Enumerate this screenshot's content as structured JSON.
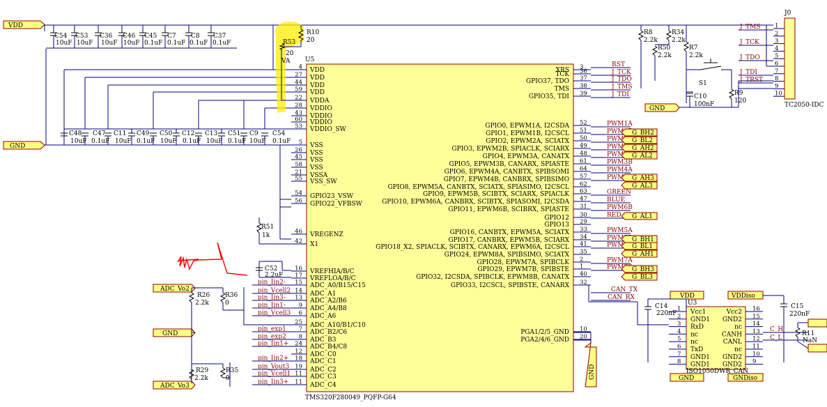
{
  "power_nets": {
    "vdd": "VDD",
    "gnd": "GND",
    "vddiso": "VDDiso",
    "gndiso": "GNDiso"
  },
  "top_caps": [
    {
      "ref": "C54",
      "val": "10uF"
    },
    {
      "ref": "C53",
      "val": "10uF"
    },
    {
      "ref": "C36",
      "val": "10uF"
    },
    {
      "ref": "C46",
      "val": "10uF"
    },
    {
      "ref": "C45",
      "val": "0.1uF"
    },
    {
      "ref": "C7",
      "val": "0.1uF"
    },
    {
      "ref": "C8",
      "val": "0.1uF"
    },
    {
      "ref": "C37",
      "val": "0.1uF"
    }
  ],
  "bottom_caps": [
    {
      "ref": "C48",
      "val": "10uF"
    },
    {
      "ref": "C47",
      "val": "0.1uF"
    },
    {
      "ref": "C11",
      "val": "10uF"
    },
    {
      "ref": "C49",
      "val": "0.1uF"
    },
    {
      "ref": "C50",
      "val": "10uF"
    },
    {
      "ref": "C12",
      "val": "0.1uF"
    },
    {
      "ref": "C13",
      "val": "10uF"
    },
    {
      "ref": "C51",
      "val": "0.1uF"
    },
    {
      "ref": "C9",
      "val": "10uF"
    },
    {
      "ref": "C54",
      "val": "0.1uF"
    }
  ],
  "r10": {
    "ref": "R10",
    "val": "20"
  },
  "r53": {
    "ref": "R53",
    "val": "20"
  },
  "va_label": "VA",
  "u5": {
    "ref": "U5",
    "part": "TMS320F280049_PQFP-G64",
    "left_pins": [
      {
        "num": "4",
        "name": "VDD"
      },
      {
        "num": "27",
        "name": "VDD"
      },
      {
        "num": "44",
        "name": "VDD"
      },
      {
        "num": "59",
        "name": "VDD"
      },
      {
        "num": "22",
        "name": "VDDA"
      },
      {
        "num": "28",
        "name": "VDDIO"
      },
      {
        "num": "43",
        "name": "VDDIO"
      },
      {
        "num": "60",
        "name": "VDDIO"
      },
      {
        "num": "53",
        "name": "VDDIO_SW"
      },
      {
        "num": "5",
        "name": "VSS"
      },
      {
        "num": "26",
        "name": "VSS"
      },
      {
        "num": "45",
        "name": "VSS"
      },
      {
        "num": "58",
        "name": "VSS"
      },
      {
        "num": "21",
        "name": "VSSA"
      },
      {
        "num": "55",
        "name": "VSS_SW"
      },
      {
        "num": "54",
        "name": "GPIO23_VSW"
      },
      {
        "num": "56",
        "name": "GPIO22_VFBSW"
      },
      {
        "num": "46",
        "name": "VREGENZ"
      },
      {
        "num": "42",
        "name": "X1"
      },
      {
        "num": "16",
        "name": "VREFHIA/B/C"
      },
      {
        "num": "17",
        "name": "VREFLOA/B/C"
      },
      {
        "num": "15",
        "name": "ADC_A0/B15/C15"
      },
      {
        "num": "14",
        "name": "ADC_A1"
      },
      {
        "num": "13",
        "name": "ADC_A2/B6"
      },
      {
        "num": "9",
        "name": "ADC_A4/B8"
      },
      {
        "num": "6",
        "name": "ADC_A6"
      },
      {
        "num": "25",
        "name": "ADC_A10/B1/C10"
      },
      {
        "num": "7",
        "name": "ADC_B2/C6"
      },
      {
        "num": "8",
        "name": "ADC_B3"
      },
      {
        "num": "24",
        "name": "ADC_B4/C8"
      },
      {
        "num": "12",
        "name": "ADC_C0"
      },
      {
        "num": "18",
        "name": "ADC_C1"
      },
      {
        "num": "19",
        "name": "ADC_C2"
      },
      {
        "num": "11",
        "name": "ADC_C3"
      },
      {
        "num": "11",
        "name": "ADC_C4"
      }
    ],
    "right_pins": [
      {
        "num": "3",
        "name": "XRS"
      },
      {
        "num": "36",
        "name": "TCK"
      },
      {
        "num": "37",
        "name": "GPIO37, TDO"
      },
      {
        "num": "38",
        "name": "TMS"
      },
      {
        "num": "39",
        "name": "GPIO35, TDI"
      },
      {
        "num": "52",
        "name": "GPIO0, EPWM1A, I2CSDA"
      },
      {
        "num": "51",
        "name": "GPIO1, EPWM1B, I2CSCL"
      },
      {
        "num": "50",
        "name": "GPIO2, EPWM2A, SCIATX"
      },
      {
        "num": "49",
        "name": "GPIO3, EPWM2B, SPIACLK, SCIARX"
      },
      {
        "num": "48",
        "name": "GPIO4, EPWM3A, CANATX"
      },
      {
        "num": "61",
        "name": "GPIO5, EPWM3B, CANARX, SPIASTE"
      },
      {
        "num": "64",
        "name": "GPIO6, EPWM4A, CANBTX, SPIBSOMI"
      },
      {
        "num": "57",
        "name": "GPIO7, EPWM4B, CANBRX, SPIBSIMO"
      },
      {
        "num": "62",
        "name": "GPIO8, EPWM5A, CANBTX, SCIATX, SPIASIMO, I2CSCL"
      },
      {
        "num": "63",
        "name": "GPIO9, EPWM5B, SCIBTX, SCIARX, SPIACLK"
      },
      {
        "num": "47",
        "name": "GPIO10, EPWM6A, CANBRX, SCIBTX, SPIASOMI, I2CSDA"
      },
      {
        "num": "31",
        "name": "GPIO11, EPWM6B, SCIBRX, SPIASTE"
      },
      {
        "num": "30",
        "name": "GPIO12"
      },
      {
        "num": "29",
        "name": "GPIO13"
      },
      {
        "num": "33",
        "name": "GPIO16, CANBTX, EPWM5A, SCIATX"
      },
      {
        "num": "34",
        "name": "GPIO17, CANBRX, EPWM5B, SCIARX"
      },
      {
        "num": "41",
        "name": "GPIO18_X2, SPIACLK, SCIBTX, CANARX, EPWM6A, I2CSCL"
      },
      {
        "num": "35",
        "name": "GPIO24, EPWM8A, SPIBSIMO, SCIATX"
      },
      {
        "num": "2",
        "name": "GPIO28, EPWM7A, SPIBCLK"
      },
      {
        "num": "1",
        "name": "GPIO29, EPWM7B, SPIBSTE"
      },
      {
        "num": "40",
        "name": "GPIO32, I2CSDA, SPIBCLK, EPWM8B, CANATX"
      },
      {
        "num": "32",
        "name": "GPIO33, I2CSCL, SPIBSTE, CANARX"
      },
      {
        "num": "10",
        "name": "PGA1/2/5_GND"
      },
      {
        "num": "20",
        "name": "PGA2/4/6_GND"
      }
    ]
  },
  "right_labels": [
    "RST",
    "J_TCK",
    "J_TDO",
    "J_TMS",
    "J_TDI",
    "PWM1A",
    "PWM1B",
    "PWM2A",
    "PWM2B",
    "PWM3A",
    "PWM3B",
    "PWM4A",
    "PWM4B",
    "GREEN",
    "BLUE",
    "PWM6B",
    "RED",
    "PWM5A",
    "PWM5B",
    "PWM6A",
    "PWM7A",
    "PWM7B",
    "CAN_TX",
    "CAN_RX"
  ],
  "gate_flags": [
    "G_BH2",
    "G_BL2",
    "G_AH2",
    "G_AL2",
    "G_AH3",
    "G_AL3",
    "G_AL1",
    "G_BH1",
    "G_BL1",
    "G_AH1",
    "G_BH3",
    "G_BL3"
  ],
  "left_labels": [
    "pin_Iin2-",
    "pin_Vcell2",
    "pin_Iin3-",
    "pin_Iin1-",
    "pin_Vcell3",
    "pin_exp1",
    "pin_exp2",
    "pin_Iin1+",
    "pin_Iin2+",
    "pin_Vout3",
    "pin_Vcell1",
    "pin_Iin3+"
  ],
  "adc_flags": {
    "vo2": "ADC_Vo2",
    "vo3": "ADC_Vo3"
  },
  "left_parts": {
    "r26": {
      "ref": "R26",
      "val": "2.2k"
    },
    "r36": {
      "ref": "R36",
      "val": "0"
    },
    "r29": {
      "ref": "R29",
      "val": "2.2k"
    },
    "r35": {
      "ref": "R35",
      "val": "0"
    },
    "r51": {
      "ref": "R51",
      "val": "1k"
    },
    "c52": {
      "ref": "C52",
      "val": "2.2uF"
    }
  },
  "jtag": {
    "r8": {
      "ref": "R8",
      "val": "2.2k"
    },
    "r34": {
      "ref": "R34",
      "val": "2.2k"
    },
    "r50": {
      "ref": "R50",
      "val": "2.2k"
    },
    "r7": {
      "ref": "R7",
      "val": "2.2k"
    },
    "s1": "S1",
    "c10": {
      "ref": "C10",
      "val": "100nF"
    },
    "r9": {
      "ref": "R9",
      "val": "120"
    },
    "j0": {
      "ref": "J0",
      "part": "TC2050-IDC"
    },
    "j0_nets": [
      "J_TMS",
      "J_TCK",
      "J_TDO",
      "J_TDI",
      "J_TRST"
    ]
  },
  "iso": {
    "ref": "U3",
    "part": "ISO1050DWR_CAN",
    "left_pins": [
      {
        "num": "1",
        "name": "Vcc1"
      },
      {
        "num": "2",
        "name": "GND1"
      },
      {
        "num": "3",
        "name": "RxD"
      },
      {
        "num": "4",
        "name": "nc"
      },
      {
        "num": "5",
        "name": "nc"
      },
      {
        "num": "6",
        "name": "TxD"
      },
      {
        "num": "7",
        "name": "GND1"
      },
      {
        "num": "8",
        "name": "GND1"
      }
    ],
    "right_pins": [
      {
        "num": "16",
        "name": "Vcc2"
      },
      {
        "num": "15",
        "name": "GND2"
      },
      {
        "num": "14",
        "name": "nc"
      },
      {
        "num": "13",
        "name": "CANH"
      },
      {
        "num": "12",
        "name": "CANL"
      },
      {
        "num": "11",
        "name": "nc"
      },
      {
        "num": "10",
        "name": "GND2"
      },
      {
        "num": "9",
        "name": "GND2"
      }
    ],
    "c14": {
      "ref": "C14",
      "val": "220nF"
    },
    "c15": {
      "ref": "C15",
      "val": "220nF"
    },
    "r11": {
      "ref": "R11",
      "val": "NaN"
    },
    "c_h": "C_H",
    "c_l": "C_L"
  },
  "colors": {
    "wire": "#00007e",
    "label": "#8b0000",
    "flag_fill": "#ffff80",
    "chip_fill": "#ffff99",
    "highlight": "#ffee00",
    "annotation": "#ff0000"
  }
}
